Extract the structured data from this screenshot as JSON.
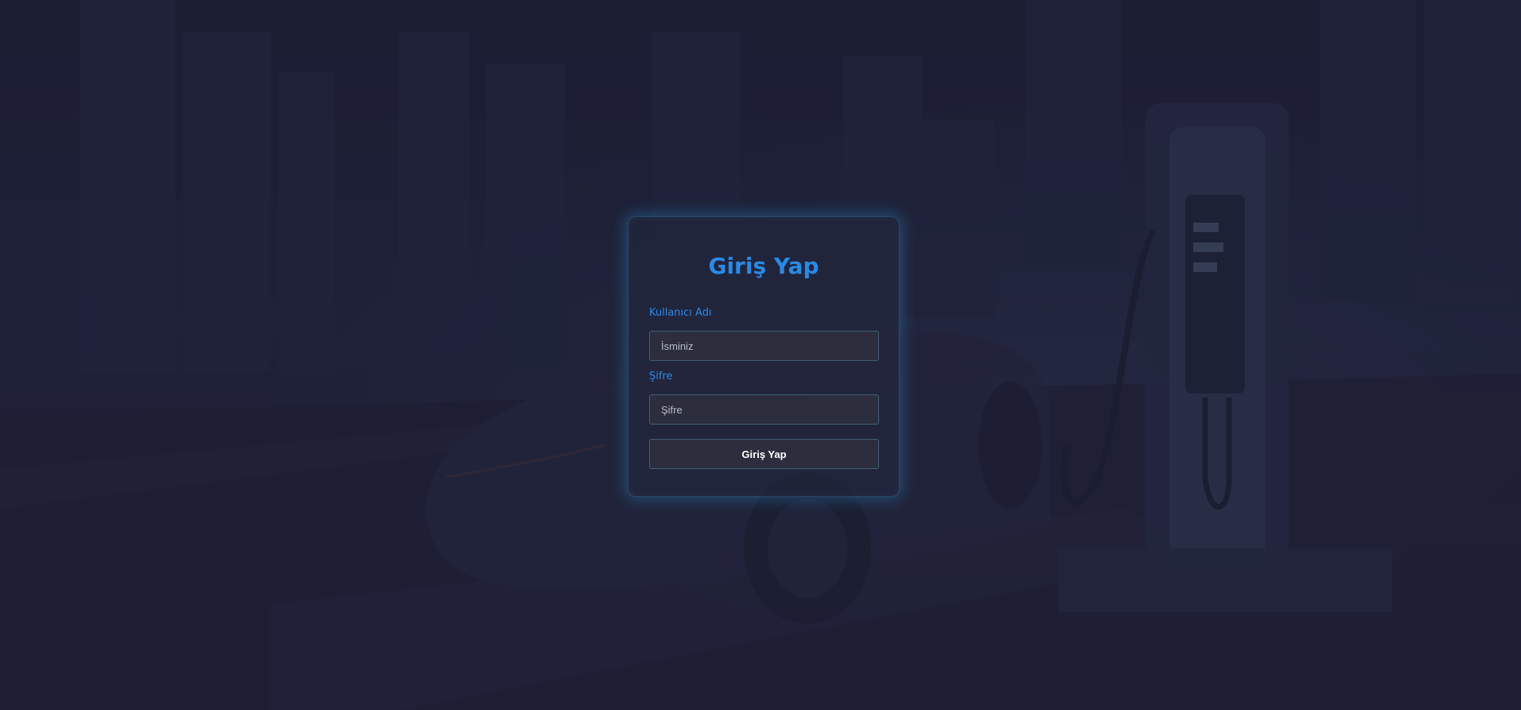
{
  "login": {
    "title": "Giriş Yap",
    "username_label": "Kullanıcı Adı",
    "username_placeholder": "İsminiz",
    "username_value": "",
    "password_label": "Şifre",
    "password_placeholder": "Şifre",
    "password_value": "",
    "submit_label": "Giriş Yap"
  },
  "colors": {
    "accent": "#2a8ae6",
    "background": "#1e2035",
    "input_background": "#2c2e3e",
    "input_border": "#3f5c78",
    "card_glow": "#2896d2"
  }
}
